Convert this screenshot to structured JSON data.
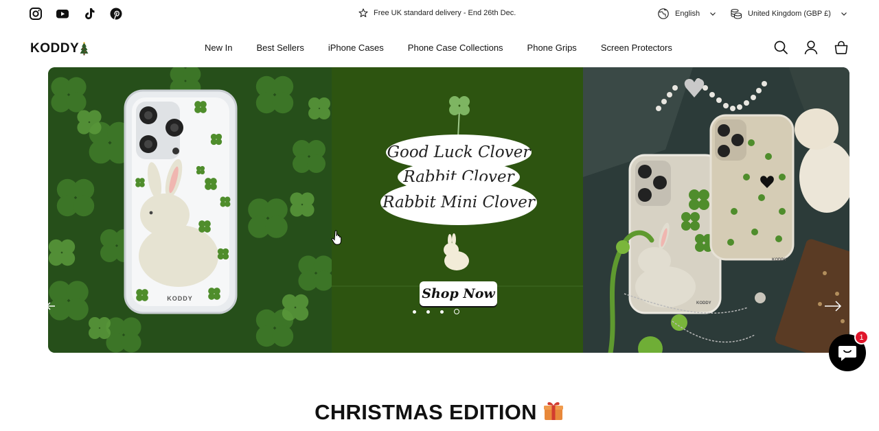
{
  "announcement": {
    "text": "Free UK standard delivery - End 26th Dec."
  },
  "locale": {
    "language": "English",
    "country": "United Kingdom (GBP £)"
  },
  "social_icons": [
    "instagram-icon",
    "youtube-icon",
    "tiktok-icon",
    "pinterest-icon"
  ],
  "brand": {
    "logo": "KODDY"
  },
  "nav": {
    "items": [
      "New In",
      "Best Sellers",
      "iPhone Cases",
      "Phone Case Collections",
      "Phone Grips",
      "Screen Protectors"
    ]
  },
  "header_icons": [
    "search-icon",
    "account-icon",
    "cart-icon"
  ],
  "hero": {
    "lines": [
      "Good Luck Clover",
      "Rabbit Clover",
      "Rabbit Mini Clover"
    ],
    "cta": "Shop Now",
    "case_brand": "KODDY",
    "slides": 4,
    "active_slide": 4
  },
  "chat": {
    "badge": "1"
  },
  "section": {
    "title": "CHRISTMAS EDITION"
  },
  "colors": {
    "hero_green": "#2d5410",
    "chat_badge": "#e0162b"
  }
}
